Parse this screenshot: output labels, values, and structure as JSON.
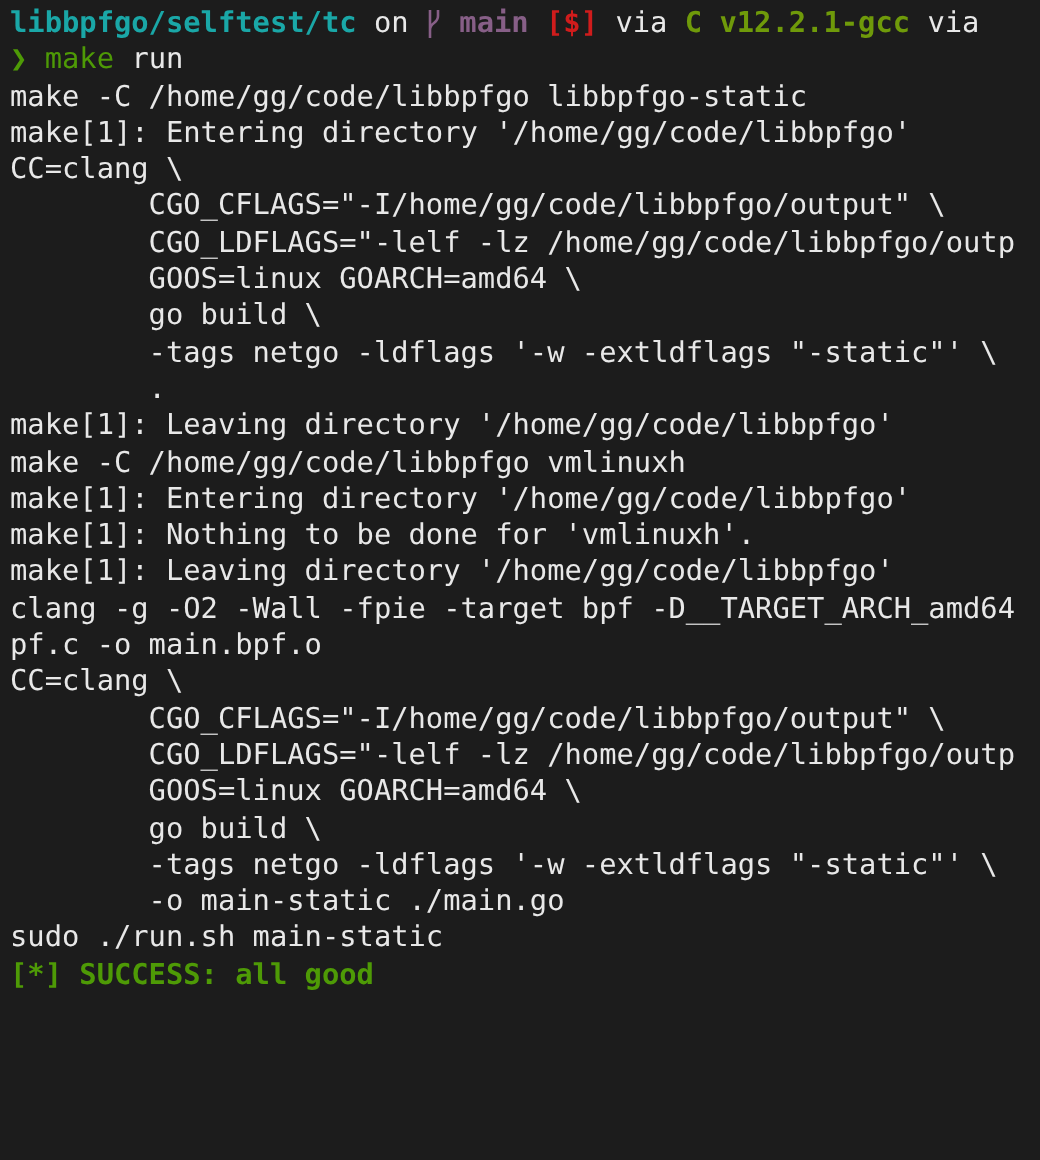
{
  "prompt": {
    "segments": [
      {
        "kind": "path",
        "text": "libbpfgo/selftest/tc"
      },
      {
        "kind": "plain",
        "text": "on"
      },
      {
        "kind": "branch",
        "text": "main"
      },
      {
        "kind": "status",
        "text": "[$]"
      },
      {
        "kind": "plain",
        "text": "via"
      },
      {
        "kind": "lang",
        "text": "C v12.2.1-gcc"
      },
      {
        "kind": "plain",
        "text": "via"
      }
    ],
    "symbol": "❯",
    "command": "make",
    "args": "run"
  },
  "output": [
    {
      "kind": "plain",
      "text": "make -C /home/gg/code/libbpfgo libbpfgo-static"
    },
    {
      "kind": "plain",
      "text": "make[1]: Entering directory '/home/gg/code/libbpfgo'"
    },
    {
      "kind": "plain",
      "text": "CC=clang \\"
    },
    {
      "kind": "plain",
      "text": "        CGO_CFLAGS=\"-I/home/gg/code/libbpfgo/output\" \\"
    },
    {
      "kind": "plain",
      "text": "        CGO_LDFLAGS=\"-lelf -lz /home/gg/code/libbpfgo/outp"
    },
    {
      "kind": "plain",
      "text": "        GOOS=linux GOARCH=amd64 \\"
    },
    {
      "kind": "plain",
      "text": "        go build \\"
    },
    {
      "kind": "plain",
      "text": "        -tags netgo -ldflags '-w -extldflags \"-static\"' \\"
    },
    {
      "kind": "plain",
      "text": "        ."
    },
    {
      "kind": "plain",
      "text": "make[1]: Leaving directory '/home/gg/code/libbpfgo'"
    },
    {
      "kind": "plain",
      "text": "make -C /home/gg/code/libbpfgo vmlinuxh"
    },
    {
      "kind": "plain",
      "text": "make[1]: Entering directory '/home/gg/code/libbpfgo'"
    },
    {
      "kind": "plain",
      "text": "make[1]: Nothing to be done for 'vmlinuxh'."
    },
    {
      "kind": "plain",
      "text": "make[1]: Leaving directory '/home/gg/code/libbpfgo'"
    },
    {
      "kind": "plain",
      "text": "clang -g -O2 -Wall -fpie -target bpf -D__TARGET_ARCH_amd64"
    },
    {
      "kind": "plain",
      "text": "pf.c -o main.bpf.o"
    },
    {
      "kind": "plain",
      "text": "CC=clang \\"
    },
    {
      "kind": "plain",
      "text": "        CGO_CFLAGS=\"-I/home/gg/code/libbpfgo/output\" \\"
    },
    {
      "kind": "plain",
      "text": "        CGO_LDFLAGS=\"-lelf -lz /home/gg/code/libbpfgo/outp"
    },
    {
      "kind": "plain",
      "text": "        GOOS=linux GOARCH=amd64 \\"
    },
    {
      "kind": "plain",
      "text": "        go build \\"
    },
    {
      "kind": "plain",
      "text": "        -tags netgo -ldflags '-w -extldflags \"-static\"' \\"
    },
    {
      "kind": "plain",
      "text": "        -o main-static ./main.go"
    },
    {
      "kind": "plain",
      "text": "sudo ./run.sh main-static"
    },
    {
      "kind": "success",
      "text": "[*] SUCCESS: all good"
    }
  ]
}
